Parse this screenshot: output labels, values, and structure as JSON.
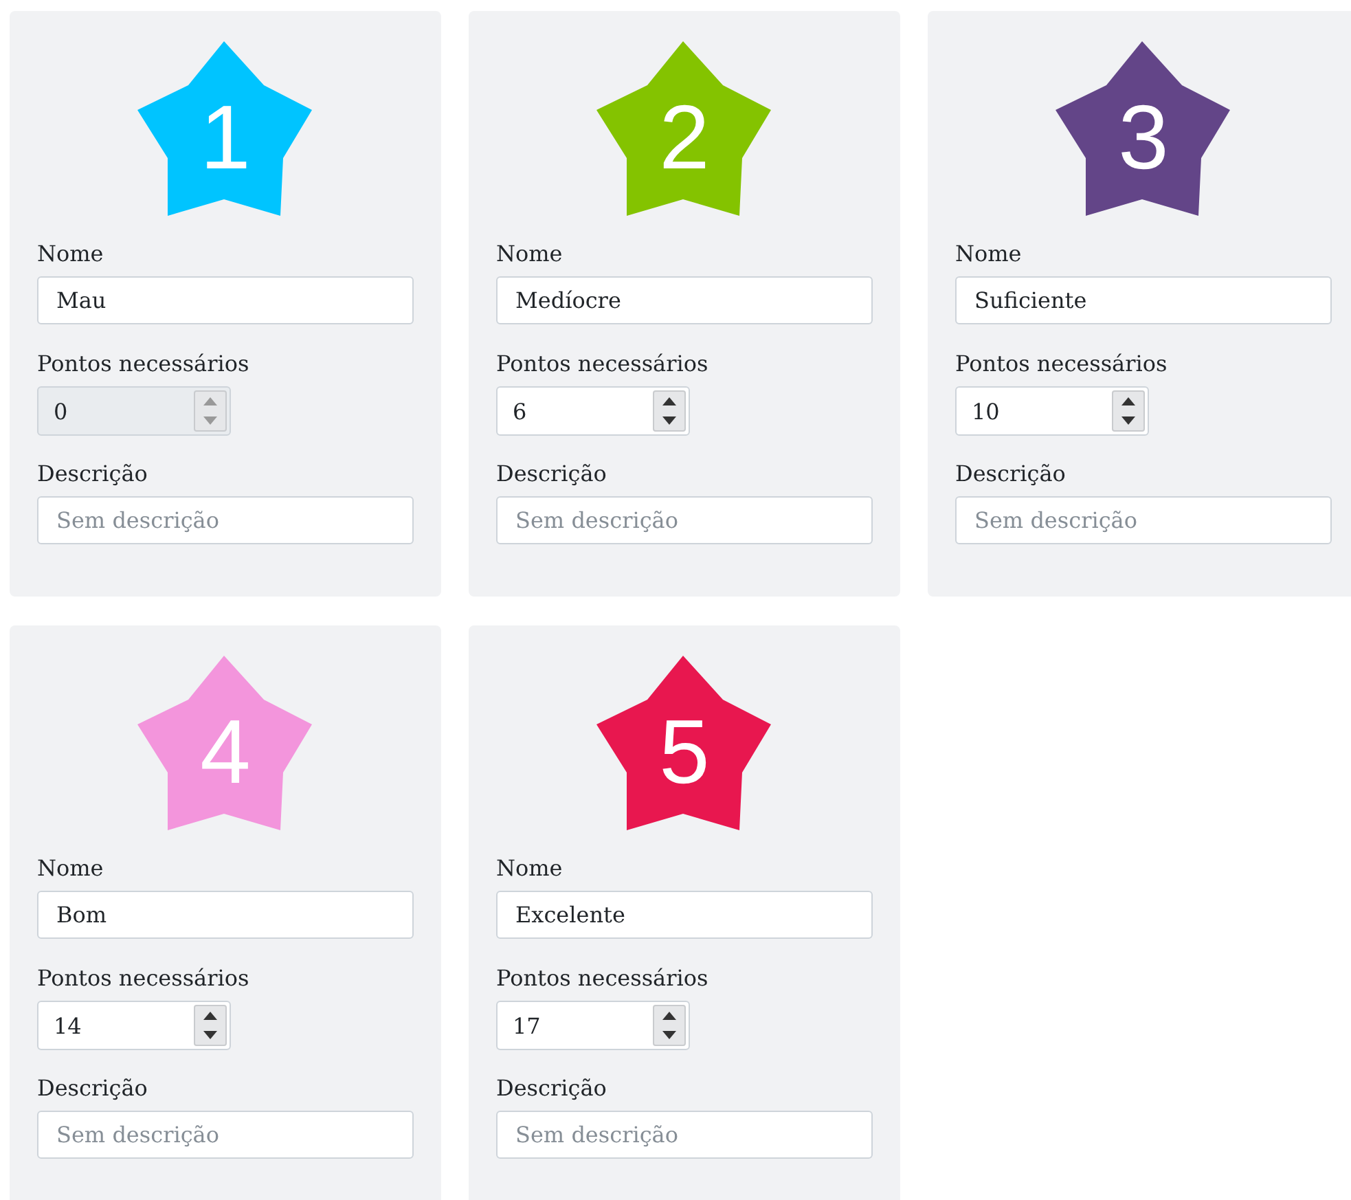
{
  "levels": [
    {
      "badge": "1",
      "color": "#00c4ff",
      "name_label": "Nome",
      "name": "Mau",
      "points_label": "Pontos necessários",
      "points": "0",
      "disabled": true,
      "description_label": "Descrição",
      "description_placeholder": "Sem descrição"
    },
    {
      "badge": "2",
      "color": "#84c300",
      "name_label": "Nome",
      "name": "Medíocre",
      "points_label": "Pontos necessários",
      "points": "6",
      "disabled": false,
      "description_label": "Descrição",
      "description_placeholder": "Sem descrição"
    },
    {
      "badge": "3",
      "color": "#634588",
      "name_label": "Nome",
      "name": "Suficiente",
      "points_label": "Pontos necessários",
      "points": "10",
      "disabled": false,
      "description_label": "Descrição",
      "description_placeholder": "Sem descrição"
    },
    {
      "badge": "4",
      "color": "#f395dc",
      "name_label": "Nome",
      "name": "Bom",
      "points_label": "Pontos necessários",
      "points": "14",
      "disabled": false,
      "description_label": "Descrição",
      "description_placeholder": "Sem descrição"
    },
    {
      "badge": "5",
      "color": "#e8174f",
      "name_label": "Nome",
      "name": "Excelente",
      "points_label": "Pontos necessários",
      "points": "17",
      "disabled": false,
      "description_label": "Descrição",
      "description_placeholder": "Sem descrição"
    }
  ]
}
